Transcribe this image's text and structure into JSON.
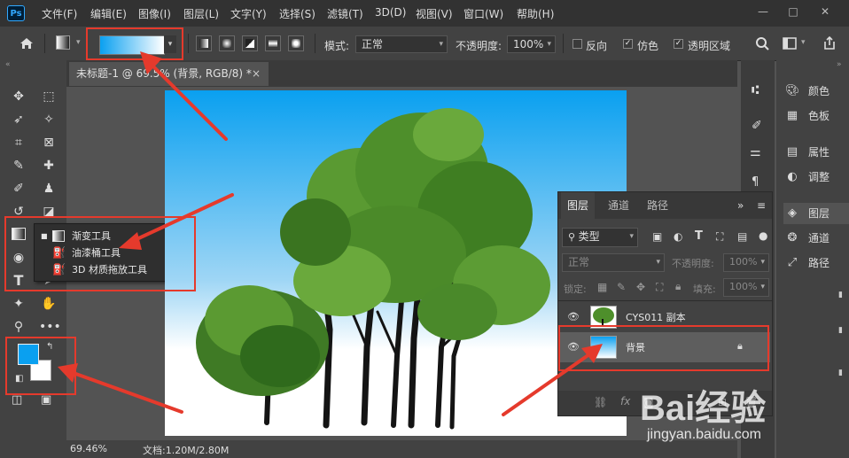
{
  "app": {
    "logo_text": "Ps"
  },
  "menu": [
    "文件(F)",
    "编辑(E)",
    "图像(I)",
    "图层(L)",
    "文字(Y)",
    "选择(S)",
    "滤镜(T)",
    "3D(D)",
    "视图(V)",
    "窗口(W)",
    "帮助(H)"
  ],
  "window_controls": {
    "minimize": "—",
    "maximize": "□",
    "close": "✕"
  },
  "options": {
    "mode_label": "模式:",
    "mode_value": "正常",
    "opacity_label": "不透明度:",
    "opacity_value": "100%",
    "reverse_label": "反向",
    "dither_label": "仿色",
    "transparency_label": "透明区域",
    "reverse_checked": false,
    "dither_checked": true,
    "transparency_checked": true,
    "gradient_start": "#0aa0f0",
    "gradient_end": "#ffffff"
  },
  "document": {
    "tab_title": "未标题-1 @ 69.5% (背景, RGB/8) *",
    "zoom": "69.46%",
    "doc_size": "文档:1.20M/2.80M"
  },
  "flyout": {
    "items": [
      {
        "label": "渐变工具",
        "key": "G",
        "active": true
      },
      {
        "label": "油漆桶工具",
        "key": "G",
        "active": false
      },
      {
        "label": "3D 材质拖放工具",
        "key": "G",
        "active": false
      }
    ]
  },
  "colors": {
    "foreground": "#0aa0f0",
    "background": "#ffffff",
    "accent_red": "#e53a2c"
  },
  "right_panel": {
    "items": [
      "颜色",
      "色板",
      "属性",
      "调整",
      "图层",
      "通道",
      "路径"
    ]
  },
  "layers_panel": {
    "tabs": [
      "图层",
      "通道",
      "路径"
    ],
    "filter_label": "类型",
    "blend_mode": "正常",
    "opacity_label": "不透明度:",
    "opacity_value": "100%",
    "lock_label": "锁定:",
    "fill_label": "填充:",
    "fill_value": "100%",
    "layers": [
      {
        "name": "CYS011 副本",
        "selected": false
      },
      {
        "name": "背景",
        "selected": true
      }
    ],
    "collapse_glyph": "»",
    "menu_glyph": "≡"
  },
  "watermark": {
    "text": "Bai经验",
    "url": "jingyan.baidu.com"
  }
}
